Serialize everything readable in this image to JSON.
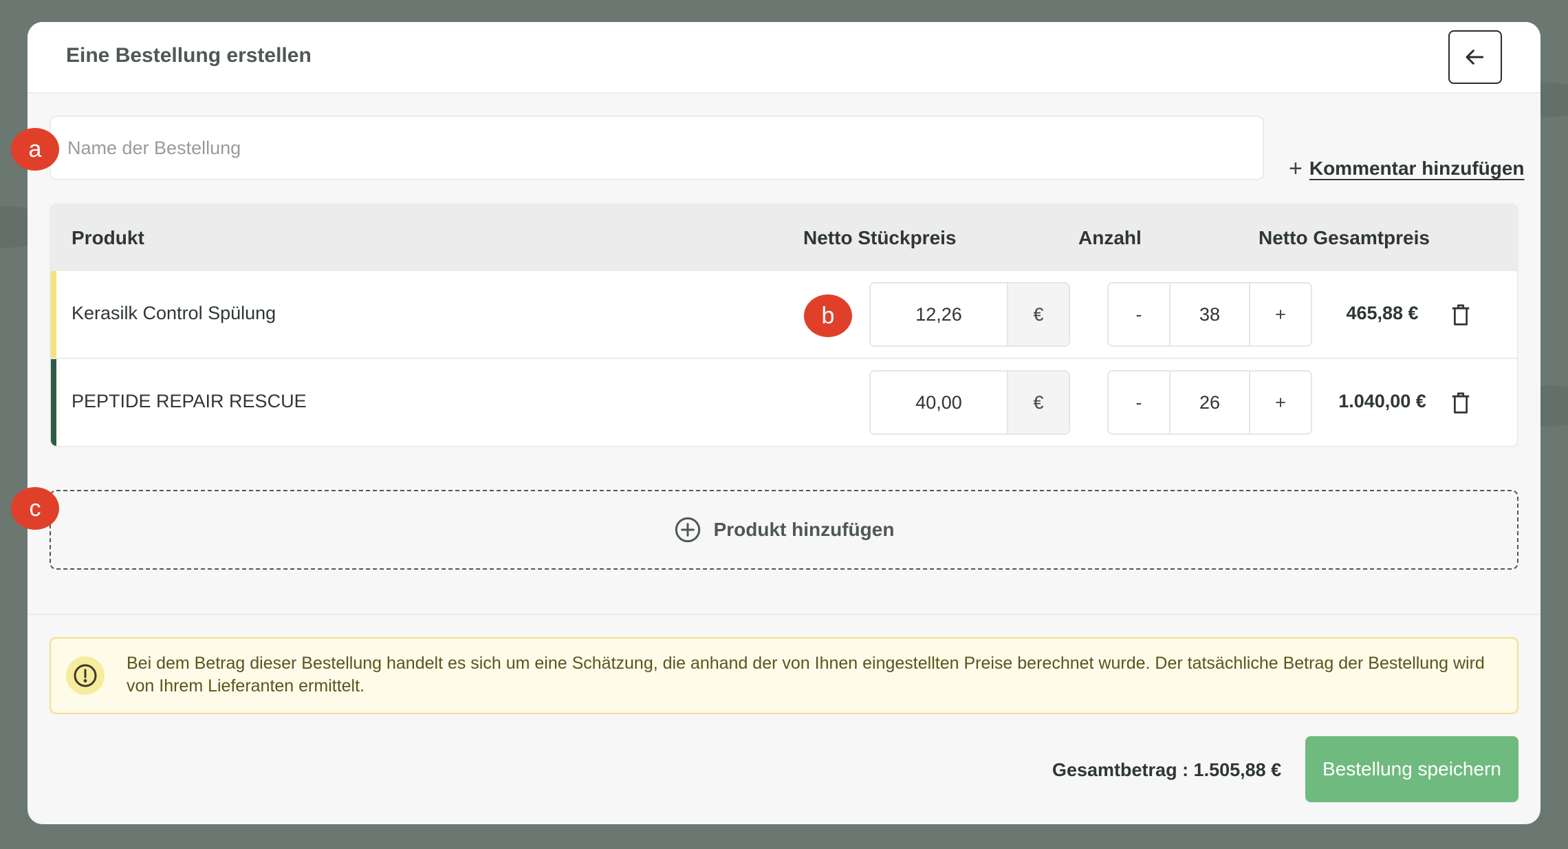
{
  "modal": {
    "title": "Eine Bestellung erstellen",
    "back_icon": "arrow-left-icon"
  },
  "order_name": {
    "placeholder": "Name der Bestellung",
    "value": ""
  },
  "comment_link": {
    "icon": "plus-icon",
    "plus_glyph": "+",
    "label": "Kommentar hinzufügen"
  },
  "table": {
    "headers": {
      "product": "Produkt",
      "unit_price": "Netto Stückpreis",
      "quantity": "Anzahl",
      "total": "Netto Gesamtpreis"
    },
    "currency_symbol": "€",
    "minus_label": "-",
    "plus_label": "+",
    "rows": [
      {
        "name": "Kerasilk Control Spülung",
        "unit_price": "12,26",
        "quantity": "38",
        "total": "465,88 €",
        "accent_color": "#f2e37a"
      },
      {
        "name": "PEPTIDE REPAIR RESCUE",
        "unit_price": "40,00",
        "quantity": "26",
        "total": "1.040,00 €",
        "accent_color": "#2f5a45"
      }
    ]
  },
  "add_product": {
    "icon": "plus-circle-icon",
    "label": "Produkt hinzufügen"
  },
  "info_banner": {
    "icon": "exclamation-circle-icon",
    "text": "Bei dem Betrag dieser Bestellung handelt es sich um eine Schätzung, die anhand der von Ihnen eingestellten Preise berechnet wurde. Der tatsächliche Betrag der Bestellung wird von Ihrem Lieferanten ermittelt."
  },
  "footer": {
    "total_label": "Gesamtbetrag : 1.505,88 €",
    "save_label": "Bestellung speichern"
  },
  "annotations": {
    "a": "a",
    "b": "b",
    "c": "c"
  },
  "colors": {
    "primary_green": "#6fba7e",
    "annotation_red": "#e0402a",
    "warning_bg": "#fefbe8"
  }
}
